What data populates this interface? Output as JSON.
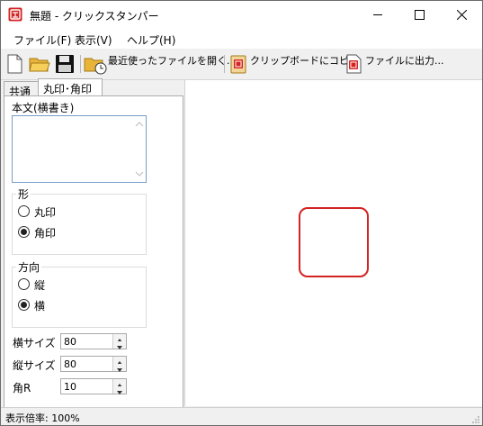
{
  "window": {
    "title": "無題 - クリックスタンパー"
  },
  "menu": {
    "file": "ファイル(F)",
    "view": "表示(V)",
    "help": "ヘルプ(H)"
  },
  "toolbar": {
    "recent_label": "最近使ったファイルを開く...",
    "clipboard_label": "クリップボードにコピー",
    "output_label": "ファイルに出力..."
  },
  "tabs": {
    "common": "共通",
    "round_square": "丸印･角印"
  },
  "form": {
    "body_text_label": "本文(横書き)",
    "body_text_value": "",
    "shape_group": "形",
    "shape_options": [
      "丸印",
      "角印"
    ],
    "shape_selected": "角印",
    "direction_group": "方向",
    "direction_options": [
      "縦",
      "横"
    ],
    "direction_selected": "横",
    "width_label": "横サイズ",
    "width_value": "80",
    "height_label": "縦サイズ",
    "height_value": "80",
    "corner_label": "角R",
    "corner_value": "10"
  },
  "stamp": {
    "color": "#d42323"
  },
  "status": {
    "zoom_text": "表示倍率: 100%"
  }
}
